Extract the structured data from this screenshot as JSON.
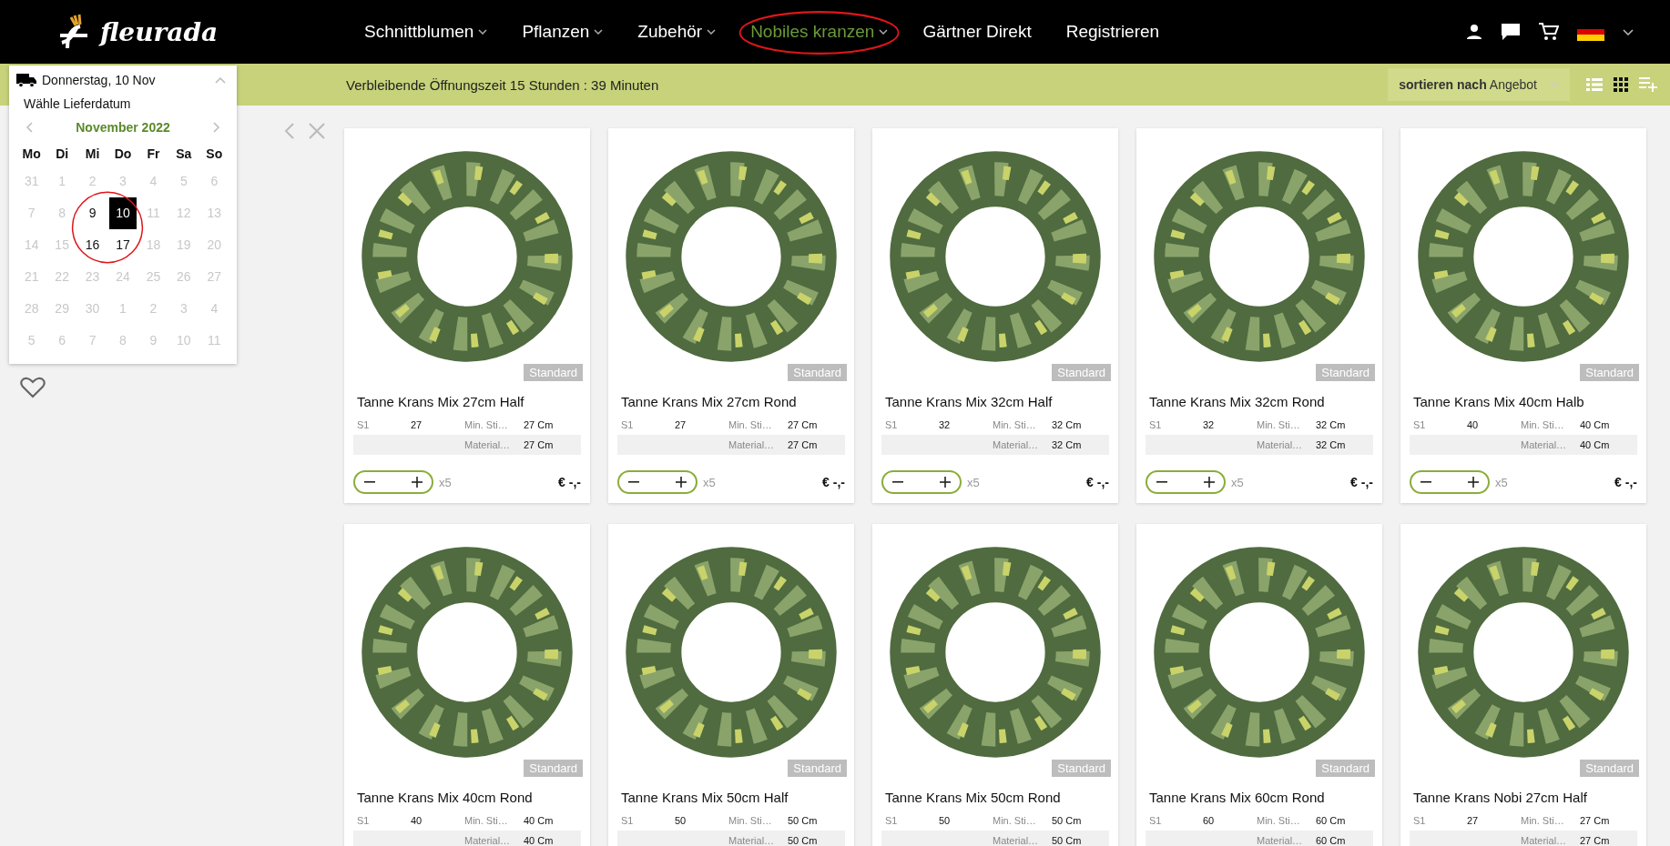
{
  "header": {
    "logo": "fleurada",
    "nav": [
      {
        "label": "Schnittblumen",
        "dropdown": true,
        "selected": false,
        "circled": false
      },
      {
        "label": "Pflanzen",
        "dropdown": true,
        "selected": false,
        "circled": false
      },
      {
        "label": "Zubehör",
        "dropdown": true,
        "selected": false,
        "circled": false
      },
      {
        "label": "Nobiles kranzen",
        "dropdown": true,
        "selected": true,
        "circled": true
      },
      {
        "label": "Gärtner Direkt",
        "dropdown": false,
        "selected": false,
        "circled": false
      },
      {
        "label": "Registrieren",
        "dropdown": false,
        "selected": false,
        "circled": false
      }
    ]
  },
  "banner": {
    "text": "Verbleibende Öffnungszeit 15 Stunden : 39 Minuten",
    "sort": "**sortieren nach** Angebot",
    "views": [
      {
        "kind": "list",
        "selected": false
      },
      {
        "kind": "grid",
        "selected": true
      },
      {
        "kind": "add-list",
        "selected": false
      }
    ]
  },
  "delivery": {
    "date": "Donnerstag, 10 Nov",
    "prompt": "Wähle Lieferdatum",
    "month": "November 2022",
    "circled": true,
    "weekdays": [
      "Mo",
      "Di",
      "Mi",
      "Do",
      "Fr",
      "Sa",
      "So"
    ],
    "weeks": [
      [
        {
          "day": "31",
          "available": false,
          "selected": false
        },
        {
          "day": "1",
          "available": false,
          "selected": false
        },
        {
          "day": "2",
          "available": false,
          "selected": false
        },
        {
          "day": "3",
          "available": false,
          "selected": false
        },
        {
          "day": "4",
          "available": false,
          "selected": false
        },
        {
          "day": "5",
          "available": false,
          "selected": false
        },
        {
          "day": "6",
          "available": false,
          "selected": false
        }
      ],
      [
        {
          "day": "7",
          "available": false,
          "selected": false
        },
        {
          "day": "8",
          "available": false,
          "selected": false
        },
        {
          "day": "9",
          "available": true,
          "selected": false
        },
        {
          "day": "10",
          "available": true,
          "selected": true
        },
        {
          "day": "11",
          "available": false,
          "selected": false
        },
        {
          "day": "12",
          "available": false,
          "selected": false
        },
        {
          "day": "13",
          "available": false,
          "selected": false
        }
      ],
      [
        {
          "day": "14",
          "available": false,
          "selected": false
        },
        {
          "day": "15",
          "available": false,
          "selected": false
        },
        {
          "day": "16",
          "available": true,
          "selected": false
        },
        {
          "day": "17",
          "available": true,
          "selected": false
        },
        {
          "day": "18",
          "available": false,
          "selected": false
        },
        {
          "day": "19",
          "available": false,
          "selected": false
        },
        {
          "day": "20",
          "available": false,
          "selected": false
        }
      ],
      [
        {
          "day": "21",
          "available": false,
          "selected": false
        },
        {
          "day": "22",
          "available": false,
          "selected": false
        },
        {
          "day": "23",
          "available": false,
          "selected": false
        },
        {
          "day": "24",
          "available": false,
          "selected": false
        },
        {
          "day": "25",
          "available": false,
          "selected": false
        },
        {
          "day": "26",
          "available": false,
          "selected": false
        },
        {
          "day": "27",
          "available": false,
          "selected": false
        }
      ],
      [
        {
          "day": "28",
          "available": false,
          "selected": false
        },
        {
          "day": "29",
          "available": false,
          "selected": false
        },
        {
          "day": "30",
          "available": false,
          "selected": false
        },
        {
          "day": "1",
          "available": false,
          "selected": false
        },
        {
          "day": "2",
          "available": false,
          "selected": false
        },
        {
          "day": "3",
          "available": false,
          "selected": false
        },
        {
          "day": "4",
          "available": false,
          "selected": false
        }
      ],
      [
        {
          "day": "5",
          "available": false,
          "selected": false
        },
        {
          "day": "6",
          "available": false,
          "selected": false
        },
        {
          "day": "7",
          "available": false,
          "selected": false
        },
        {
          "day": "8",
          "available": false,
          "selected": false
        },
        {
          "day": "9",
          "available": false,
          "selected": false
        },
        {
          "day": "10",
          "available": false,
          "selected": false
        },
        {
          "day": "11",
          "available": false,
          "selected": false
        }
      ]
    ]
  },
  "products": [
    {
      "name": "Tanne Krans Mix 27cm Half",
      "badge": "Standard",
      "size_label": "S1",
      "size": "27",
      "min_label": "Min. Sti…",
      "min": "27 Cm",
      "material_label": "Material…",
      "material": "27 Cm",
      "qty": "x5",
      "price": "€ -,-"
    },
    {
      "name": "Tanne Krans Mix 27cm Rond",
      "badge": "Standard",
      "size_label": "S1",
      "size": "27",
      "min_label": "Min. Sti…",
      "min": "27 Cm",
      "material_label": "Material…",
      "material": "27 Cm",
      "qty": "x5",
      "price": "€ -,-"
    },
    {
      "name": "Tanne Krans Mix 32cm Half",
      "badge": "Standard",
      "size_label": "S1",
      "size": "32",
      "min_label": "Min. Sti…",
      "min": "32 Cm",
      "material_label": "Material…",
      "material": "32 Cm",
      "qty": "x5",
      "price": "€ -,-"
    },
    {
      "name": "Tanne Krans Mix 32cm Rond",
      "badge": "Standard",
      "size_label": "S1",
      "size": "32",
      "min_label": "Min. Sti…",
      "min": "32 Cm",
      "material_label": "Material…",
      "material": "32 Cm",
      "qty": "x5",
      "price": "€ -,-"
    },
    {
      "name": "Tanne Krans Mix 40cm Halb",
      "badge": "Standard",
      "size_label": "S1",
      "size": "40",
      "min_label": "Min. Sti…",
      "min": "40 Cm",
      "material_label": "Material…",
      "material": "40 Cm",
      "qty": "x5",
      "price": "€ -,-"
    },
    {
      "name": "Tanne Krans Mix 40cm Rond",
      "badge": "Standard",
      "size_label": "S1",
      "size": "40",
      "min_label": "Min. Sti…",
      "min": "40 Cm",
      "material_label": "Material…",
      "material": "40 Cm"
    },
    {
      "name": "Tanne Krans Mix 50cm Half",
      "badge": "Standard",
      "size_label": "S1",
      "size": "50",
      "min_label": "Min. Sti…",
      "min": "50 Cm",
      "material_label": "Material…",
      "material": "50 Cm"
    },
    {
      "name": "Tanne Krans Mix 50cm Rond",
      "badge": "Standard",
      "size_label": "S1",
      "size": "50",
      "min_label": "Min. Sti…",
      "min": "50 Cm",
      "material_label": "Material…",
      "material": "50 Cm"
    },
    {
      "name": "Tanne Krans Mix 60cm Rond",
      "badge": "Standard",
      "size_label": "S1",
      "size": "60",
      "min_label": "Min. Sti…",
      "min": "60 Cm",
      "material_label": "Material…",
      "material": "60 Cm"
    },
    {
      "name": "Tanne Krans Nobi 27cm Half",
      "badge": "Standard",
      "size_label": "S1",
      "size": "27",
      "min_label": "Min. Sti…",
      "min": "27 Cm",
      "material_label": "Material…",
      "material": "27 Cm"
    }
  ]
}
